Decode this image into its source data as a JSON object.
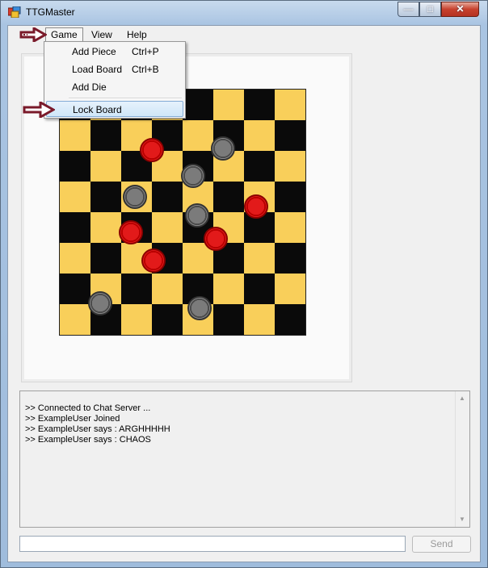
{
  "window": {
    "title": "TTGMaster",
    "minimize_icon": "minimize-icon",
    "maximize_icon": "maximize-icon",
    "close_icon": "close-icon"
  },
  "menu": {
    "items": [
      "Game",
      "View",
      "Help"
    ],
    "open": "Game",
    "dropdown": [
      {
        "label": "Add Piece",
        "shortcut": "Ctrl+P"
      },
      {
        "label": "Load Board",
        "shortcut": "Ctrl+B"
      },
      {
        "label": "Add Die",
        "shortcut": ""
      },
      {
        "label": "Lock Board",
        "shortcut": ""
      }
    ],
    "highlighted": "Lock Board"
  },
  "board": {
    "rows": 8,
    "cols": 8,
    "colors": {
      "dark": "#0a0a0a",
      "light": "#f9cf5a"
    },
    "pieces": [
      {
        "color": "red"
      },
      {
        "color": "grey"
      },
      {
        "color": "grey"
      },
      {
        "color": "grey"
      },
      {
        "color": "red"
      },
      {
        "color": "grey"
      },
      {
        "color": "red"
      },
      {
        "color": "red"
      },
      {
        "color": "red"
      },
      {
        "color": "grey"
      },
      {
        "color": "grey"
      }
    ]
  },
  "chat": {
    "lines": [
      ">> Connected to Chat Server ...",
      ">> ExampleUser Joined",
      ">> ExampleUser says : ARGHHHHH",
      ">> ExampleUser says : CHAOS"
    ]
  },
  "input": {
    "value": ""
  },
  "send": {
    "label": "Send"
  },
  "annotations": {
    "arrow_color": "#7a1a2a"
  }
}
